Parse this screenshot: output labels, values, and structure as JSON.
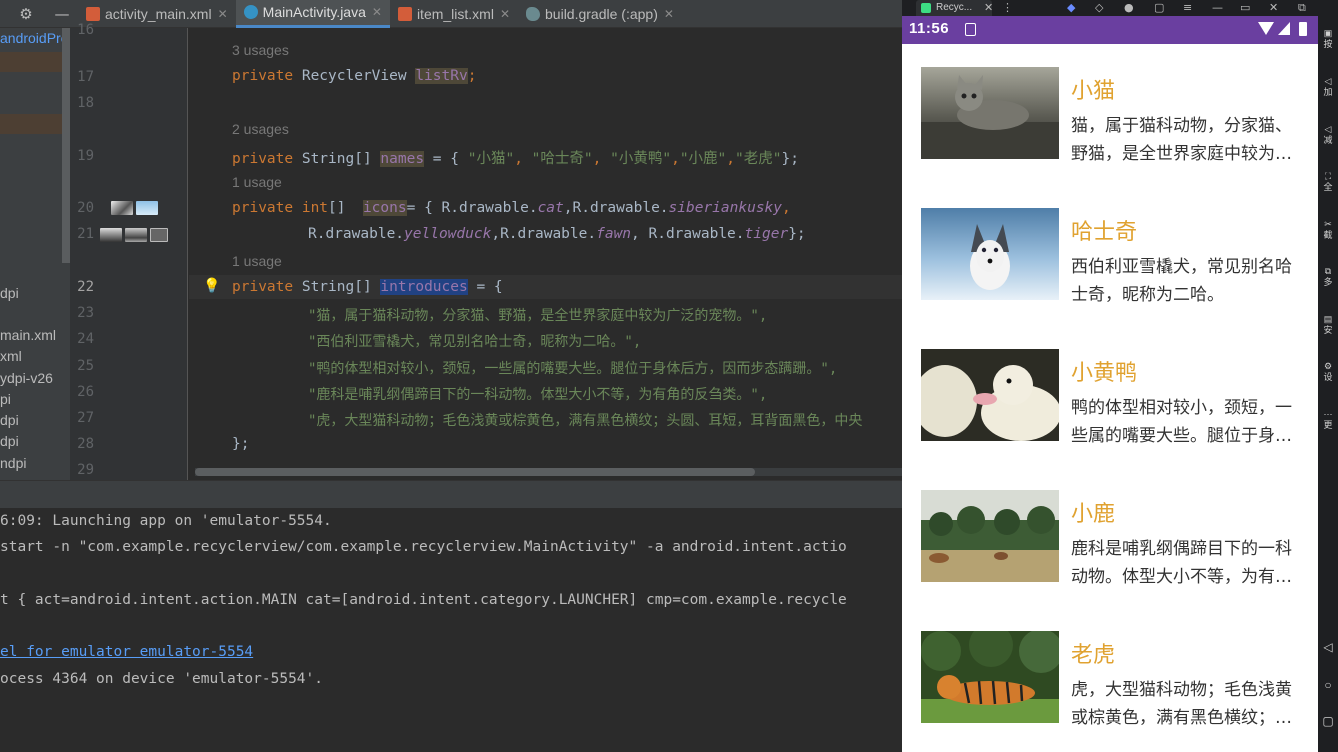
{
  "ide": {
    "tabs": [
      {
        "label": "activity_main.xml",
        "type": "xml",
        "active": false
      },
      {
        "label": "MainActivity.java",
        "type": "java",
        "active": true
      },
      {
        "label": "item_list.xml",
        "type": "xml",
        "active": false
      },
      {
        "label": "build.gradle (:app)",
        "type": "gradle",
        "active": false
      }
    ],
    "project_items": [
      "androidProje",
      "dpi",
      "main.xml",
      "xml",
      "ydpi-v26",
      "pi",
      "dpi",
      "dpi",
      "ndpi"
    ],
    "line_numbers": [
      "16",
      "17",
      "18",
      "19",
      "20",
      "21",
      "22",
      "23",
      "24",
      "25",
      "26",
      "27",
      "28",
      "29"
    ],
    "hints": {
      "u17": "3 usages",
      "u19": "2 usages",
      "u20": "1 usage",
      "u22": "1 usage"
    },
    "code": {
      "l17": {
        "kw": "private",
        "type": " RecyclerView ",
        "name": "listRv",
        "end": ";"
      },
      "l19": {
        "kw": "private",
        "type": " String[] ",
        "name": "names",
        "pre": " = { ",
        "s1": "\"小猫\"",
        "c1": ", ",
        "s2": "\"哈士奇\"",
        "c2": ", ",
        "s3": "\"小黄鸭\"",
        "c3": ",",
        "s4": "\"小鹿\"",
        "c4": ",",
        "s5": "\"老虎\"",
        "end": "};"
      },
      "l20": {
        "kw1": "private",
        "kw2": " int",
        "br": "[]  ",
        "name": "icons",
        "pre": "= { R.drawable.",
        "i1": "cat",
        "c1": ",R.drawable.",
        "i2": "siberiankusky",
        "end": ","
      },
      "l21": {
        "p1": "R.drawable.",
        "i1": "yellowduck",
        "c1": ",R.drawable.",
        "i2": "fawn",
        "c2": ", R.drawable.",
        "i3": "tiger",
        "end": "};"
      },
      "l22": {
        "kw": "private",
        "type": " String[] ",
        "name": "introduces",
        "end": " = {"
      },
      "l23": "\"猫，属于猫科动物，分家猫、野猫，是全世界家庭中较为广泛的宠物。\",",
      "l24": "\"西伯利亚雪橇犬，常见别名哈士奇，昵称为二哈。\",",
      "l25": "\"鸭的体型相对较小，颈短，一些属的嘴要大些。腿位于身体后方，因而步态蹒跚。\",",
      "l26": "\"鹿科是哺乳纲偶蹄目下的一科动物。体型大小不等，为有角的反刍类。\",",
      "l27": "\"虎，大型猫科动物；毛色浅黄或棕黄色，满有黑色横纹；头圆、耳短，耳背面黑色，中央",
      "l28": "};"
    },
    "run_lines": [
      "6:09: Launching app on 'emulator-5554.",
      "start -n \"com.example.recyclerview/com.example.recyclerview.MainActivity\" -a android.intent.actio",
      "",
      "t { act=android.intent.action.MAIN cat=[android.intent.category.LAUNCHER] cmp=com.example.recycle",
      "",
      "el for emulator emulator-5554",
      "ocess 4364 on device 'emulator-5554'."
    ]
  },
  "emulator": {
    "window_tab": "Recyc...",
    "clock": "11:56",
    "side_labels": [
      "按",
      "加",
      "减",
      "全",
      "截",
      "多",
      "安",
      "设",
      "更"
    ],
    "items": [
      {
        "title": "小猫",
        "desc": "猫，属于猫科动物，分家猫、野猫，是全世界家庭中较为广泛的宠物。"
      },
      {
        "title": "哈士奇",
        "desc": "西伯利亚雪橇犬，常见别名哈士奇，昵称为二哈。"
      },
      {
        "title": "小黄鸭",
        "desc": "鸭的体型相对较小，颈短，一些属的嘴要大些。腿位于身体后方，因而步态蹒跚。"
      },
      {
        "title": "小鹿",
        "desc": "鹿科是哺乳纲偶蹄目下的一科动物。体型大小不等，为有角的反刍类。"
      },
      {
        "title": "老虎",
        "desc": "虎，大型猫科动物；毛色浅黄或棕黄色，满有黑色横纹；头圆、耳短，耳背面黑色，中央"
      }
    ]
  },
  "colors": {
    "accent": "#e0a230",
    "statusbar": "#6a3fa0",
    "keyword": "#cc7832",
    "field": "#9876aa",
    "string": "#6a8759"
  }
}
